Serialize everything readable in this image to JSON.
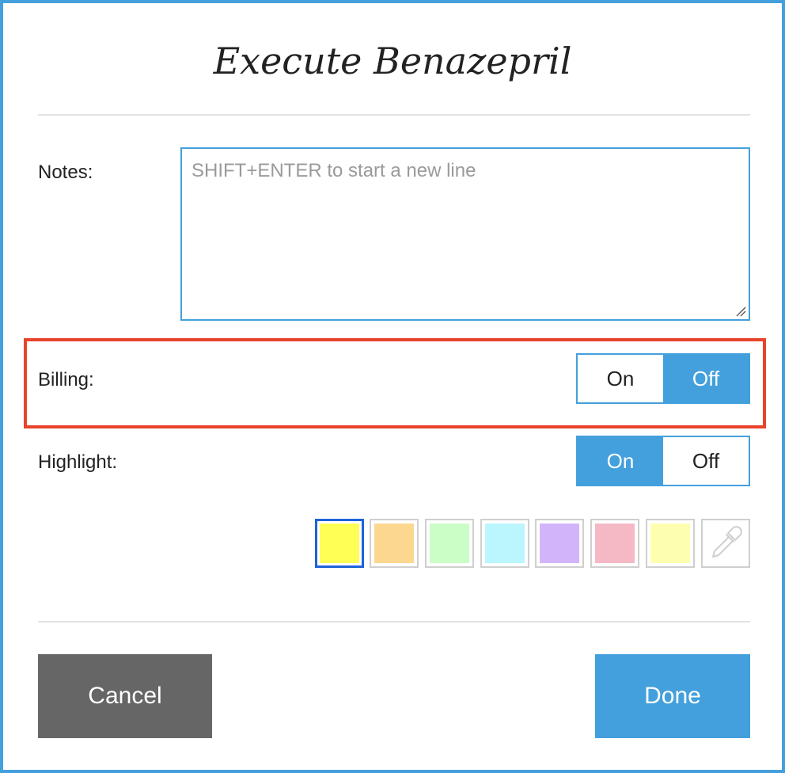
{
  "dialog": {
    "title": "Execute Benazepril"
  },
  "notes": {
    "label": "Notes:",
    "placeholder": "SHIFT+ENTER to start a new line",
    "value": ""
  },
  "billing": {
    "label": "Billing:",
    "on_label": "On",
    "off_label": "Off",
    "selected": "Off"
  },
  "highlight": {
    "label": "Highlight:",
    "on_label": "On",
    "off_label": "Off",
    "selected": "On",
    "swatches": [
      {
        "name": "yellow",
        "color": "#ffff55",
        "selected": true
      },
      {
        "name": "orange",
        "color": "#fbd78f",
        "selected": false
      },
      {
        "name": "green",
        "color": "#cbfec6",
        "selected": false
      },
      {
        "name": "cyan",
        "color": "#bbf5fd",
        "selected": false
      },
      {
        "name": "purple",
        "color": "#d2b4fa",
        "selected": false
      },
      {
        "name": "pink",
        "color": "#f5b8c5",
        "selected": false
      },
      {
        "name": "light-yellow",
        "color": "#fefeb0",
        "selected": false
      },
      {
        "name": "eyedropper",
        "icon": "eyedropper-icon",
        "selected": false
      }
    ]
  },
  "actions": {
    "cancel_label": "Cancel",
    "done_label": "Done"
  },
  "colors": {
    "accent": "#43a0dc",
    "highlight_frame": "#e8432b",
    "cancel_bg": "#666666"
  }
}
